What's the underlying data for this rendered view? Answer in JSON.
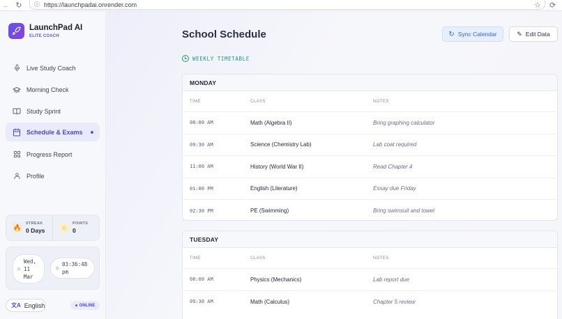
{
  "browser": {
    "url": "https://launchpadai.onrender.com",
    "back_icon": "arrow-left",
    "reload_icon": "reload",
    "star_icon": "star",
    "extension_icon": "extension"
  },
  "app": {
    "name": "LaunchPad AI",
    "subtitle": "ELITE COACH",
    "accent": "#5b57e6"
  },
  "sidebar": {
    "items": [
      {
        "label": "Live Study Coach",
        "icon": "microphone"
      },
      {
        "label": "Morning Check",
        "icon": "graduation-cap"
      },
      {
        "label": "Study Sprint",
        "icon": "book-open"
      },
      {
        "label": "Schedule & Exams",
        "icon": "calendar",
        "active": true
      },
      {
        "label": "Progress Report",
        "icon": "grid"
      },
      {
        "label": "Profile",
        "icon": "user"
      }
    ],
    "streak": {
      "label": "STREAK",
      "value": "0 Days"
    },
    "points": {
      "label": "POINTS",
      "value": "0"
    },
    "date_text": "Wed,\n11\nMar",
    "time_text": "03:36:48\npm",
    "language": "English",
    "status": "ONLINE"
  },
  "main": {
    "title": "School Schedule",
    "sync_label": "Sync Calendar",
    "edit_label": "Edit Data",
    "section_label": "WEEKLY TIMETABLE",
    "columns": {
      "time": "TIME",
      "class": "CLASS",
      "notes": "NOTES"
    },
    "days": [
      {
        "name": "MONDAY",
        "rows": [
          {
            "time": "08:00 AM",
            "class": "Math (Algebra II)",
            "notes": "Bring graphing calculator"
          },
          {
            "time": "09:30 AM",
            "class": "Science (Chemistry Lab)",
            "notes": "Lab coat required"
          },
          {
            "time": "11:00 AM",
            "class": "History (World War II)",
            "notes": "Read Chapter 4"
          },
          {
            "time": "01:00 PM",
            "class": "English (Literature)",
            "notes": "Essay due Friday"
          },
          {
            "time": "02:30 PM",
            "class": "PE (Swimming)",
            "notes": "Bring swimsuit and towel"
          }
        ]
      },
      {
        "name": "TUESDAY",
        "rows": [
          {
            "time": "08:00 AM",
            "class": "Physics (Mechanics)",
            "notes": "Lab report due"
          },
          {
            "time": "09:30 AM",
            "class": "Math (Calculus)",
            "notes": "Chapter 5 review"
          }
        ]
      }
    ]
  }
}
